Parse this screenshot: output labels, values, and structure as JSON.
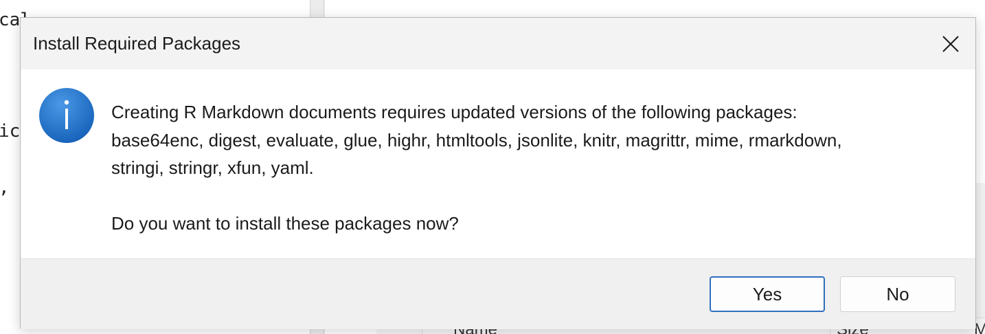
{
  "background": {
    "editor_fragments": [
      "cal",
      "ic",
      ","
    ],
    "files_columns": [
      "Name",
      "Size",
      "M"
    ]
  },
  "dialog": {
    "title": "Install Required Packages",
    "close_icon": "close-icon",
    "message_icon": "info-icon",
    "message_lines": [
      "Creating R Markdown documents requires updated versions of the following packages:",
      "base64enc, digest, evaluate, glue, highr, htmltools, jsonlite, knitr, magrittr, mime, rmarkdown,",
      "stringi, stringr, xfun, yaml."
    ],
    "question": "Do you want to install these packages now?",
    "buttons": {
      "yes": "Yes",
      "no": "No"
    },
    "colors": {
      "accent": "#2f6fbf",
      "icon_blue": "#1f6fc8"
    }
  }
}
